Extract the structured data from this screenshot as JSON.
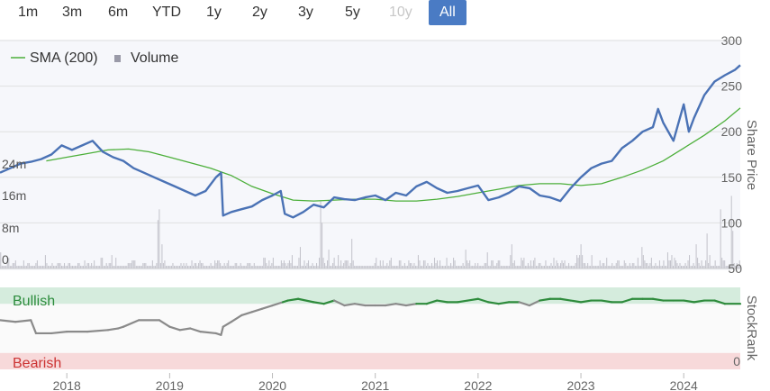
{
  "range_selector": {
    "buttons": [
      {
        "label": "1m",
        "state": "normal"
      },
      {
        "label": "3m",
        "state": "normal"
      },
      {
        "label": "6m",
        "state": "normal"
      },
      {
        "label": "YTD",
        "state": "normal"
      },
      {
        "label": "1y",
        "state": "normal"
      },
      {
        "label": "2y",
        "state": "normal"
      },
      {
        "label": "3y",
        "state": "normal"
      },
      {
        "label": "5y",
        "state": "normal"
      },
      {
        "label": "10y",
        "state": "disabled"
      },
      {
        "label": "All",
        "state": "active"
      }
    ]
  },
  "colors": {
    "price": "#4a72b5",
    "sma": "#4caf3a",
    "volume": "#c4c4cc",
    "bullish_band": "#d5ecdd",
    "bearish_band": "#f7d9da",
    "bullish_text": "#2c8c3c",
    "bearish_text": "#cc3333",
    "rank_bull": "#2e8b3c",
    "rank_neutral": "#8a8a8a",
    "grid": "#e0e0e0"
  },
  "chart_data": [
    {
      "type": "line",
      "name": "price-panel",
      "legend": [
        {
          "label": "SMA (200)",
          "icon": "line"
        },
        {
          "label": "Volume",
          "icon": "square"
        }
      ],
      "x_ticks": [
        "2018",
        "2019",
        "2020",
        "2021",
        "2022",
        "2023",
        "2024"
      ],
      "x_range": [
        2017.35,
        2024.55
      ],
      "y_axis_right": {
        "label": "Share Price",
        "ticks": [
          "50",
          "100",
          "150",
          "200",
          "250",
          "300"
        ],
        "ylim": [
          50,
          300
        ]
      },
      "y_axis_volume": {
        "ticks": [
          "0",
          "8m",
          "16m",
          "24m"
        ],
        "ylim": [
          0,
          35
        ]
      },
      "series": [
        {
          "name": "Price",
          "x": [
            2017.35,
            2017.45,
            2017.55,
            2017.65,
            2017.75,
            2017.85,
            2017.95,
            2018.05,
            2018.15,
            2018.25,
            2018.35,
            2018.45,
            2018.55,
            2018.65,
            2018.75,
            2018.85,
            2018.95,
            2019.05,
            2019.15,
            2019.25,
            2019.35,
            2019.45,
            2019.5,
            2019.52,
            2019.6,
            2019.7,
            2019.8,
            2019.9,
            2020.0,
            2020.08,
            2020.12,
            2020.2,
            2020.3,
            2020.4,
            2020.5,
            2020.6,
            2020.7,
            2020.8,
            2020.9,
            2021.0,
            2021.1,
            2021.2,
            2021.3,
            2021.4,
            2021.5,
            2021.6,
            2021.7,
            2021.8,
            2021.9,
            2022.0,
            2022.1,
            2022.2,
            2022.3,
            2022.4,
            2022.5,
            2022.6,
            2022.7,
            2022.8,
            2022.9,
            2023.0,
            2023.1,
            2023.2,
            2023.3,
            2023.4,
            2023.5,
            2023.6,
            2023.7,
            2023.75,
            2023.8,
            2023.9,
            2024.0,
            2024.05,
            2024.1,
            2024.2,
            2024.3,
            2024.4,
            2024.5,
            2024.55
          ],
          "values": [
            155,
            160,
            165,
            167,
            170,
            175,
            185,
            180,
            185,
            190,
            178,
            172,
            168,
            160,
            155,
            150,
            145,
            140,
            135,
            130,
            135,
            150,
            155,
            108,
            112,
            115,
            118,
            125,
            130,
            135,
            110,
            106,
            112,
            120,
            117,
            128,
            126,
            125,
            128,
            130,
            125,
            133,
            130,
            140,
            145,
            138,
            133,
            135,
            138,
            141,
            125,
            128,
            133,
            140,
            138,
            130,
            128,
            124,
            138,
            150,
            160,
            165,
            168,
            182,
            190,
            200,
            205,
            225,
            210,
            190,
            230,
            200,
            215,
            240,
            255,
            262,
            268,
            273
          ]
        },
        {
          "name": "SMA (200)",
          "x": [
            2017.8,
            2018.0,
            2018.2,
            2018.4,
            2018.6,
            2018.8,
            2019.0,
            2019.2,
            2019.4,
            2019.6,
            2019.8,
            2020.0,
            2020.2,
            2020.4,
            2020.6,
            2020.8,
            2021.0,
            2021.2,
            2021.4,
            2021.6,
            2021.8,
            2022.0,
            2022.2,
            2022.4,
            2022.6,
            2022.8,
            2023.0,
            2023.2,
            2023.4,
            2023.6,
            2023.8,
            2024.0,
            2024.2,
            2024.4,
            2024.55
          ],
          "values": [
            168,
            172,
            176,
            180,
            181,
            178,
            172,
            166,
            160,
            152,
            140,
            132,
            125,
            124,
            125,
            126,
            126,
            124,
            124,
            126,
            129,
            133,
            137,
            141,
            143,
            143,
            141,
            143,
            150,
            158,
            168,
            182,
            196,
            212,
            226
          ]
        }
      ]
    },
    {
      "type": "bar",
      "name": "volume",
      "x_range": [
        2017.35,
        2024.55
      ],
      "values": [
        6,
        1,
        1,
        1,
        1,
        3,
        4,
        1,
        1,
        2,
        2,
        3,
        1,
        1,
        1,
        1,
        1,
        3,
        1,
        1,
        2,
        2,
        1,
        1,
        1,
        1,
        2,
        3,
        1,
        1,
        1,
        1,
        1,
        5,
        2,
        1,
        1,
        1,
        2,
        1,
        1,
        1,
        2,
        2,
        2,
        1,
        1,
        2,
        1,
        1,
        2,
        2,
        1,
        1,
        1,
        1,
        1,
        2,
        2,
        1,
        1,
        1,
        3,
        1,
        2,
        2,
        1,
        2,
        1,
        3,
        1,
        1,
        1,
        1,
        4,
        4,
        1,
        1,
        2,
        1,
        2,
        2,
        5,
        1,
        1,
        4,
        1,
        1,
        1,
        1,
        1,
        1,
        1,
        1,
        2,
        2,
        2,
        3,
        3,
        3,
        1,
        1,
        1,
        1,
        1,
        2,
        2,
        2,
        1,
        1,
        1,
        1,
        3,
        1,
        1,
        2,
        18,
        22,
        2,
        9,
        2,
        3,
        1,
        1,
        1,
        1,
        1,
        2,
        1,
        1,
        1,
        1,
        1,
        2,
        1,
        2,
        1,
        2,
        1,
        1,
        1,
        3,
        1,
        2,
        2,
        1,
        2,
        3,
        2,
        2,
        1,
        1,
        1,
        1,
        1,
        2,
        1,
        1,
        3,
        2,
        3,
        3,
        2,
        1,
        1,
        2,
        1,
        2,
        3,
        1,
        1,
        1,
        1,
        2,
        2,
        1,
        1,
        2,
        1,
        1,
        1,
        1,
        2,
        2,
        2,
        1,
        1,
        2,
        1,
        1,
        1,
        1,
        1,
        1,
        4,
        4,
        2,
        1,
        3,
        1,
        2,
        4,
        1,
        1,
        1,
        1,
        1,
        3,
        2,
        3,
        2,
        1,
        2,
        3,
        2,
        5,
        1,
        1,
        1,
        1,
        4,
        8,
        1,
        1,
        3,
        1,
        2,
        3,
        1,
        1,
        2,
        1,
        1,
        2,
        1,
        4,
        25,
        17,
        4,
        2,
        1,
        3,
        7,
        1,
        1,
        2,
        4,
        1,
        1,
        5,
        1,
        3,
        1,
        2,
        3,
        3,
        3,
        1,
        2,
        11,
        3,
        1,
        1,
        1,
        1,
        1,
        1,
        1,
        1,
        1,
        1,
        1,
        1,
        1,
        1,
        1,
        2,
        4,
        1,
        1,
        3,
        1,
        3,
        1,
        1,
        2,
        1,
        3,
        4,
        1,
        1,
        1,
        1,
        1,
        3,
        3,
        1,
        1,
        2,
        1,
        1,
        3,
        2,
        2,
        1,
        2,
        1,
        1,
        5,
        3,
        1,
        1,
        3,
        3,
        1,
        2,
        1,
        1,
        2,
        1,
        4,
        2,
        3,
        1,
        3,
        1,
        1,
        1,
        1,
        4,
        1,
        1,
        2,
        1,
        4,
        3,
        1,
        1,
        1,
        1,
        1,
        2,
        1,
        7,
        3,
        2,
        3,
        1,
        1,
        1,
        2,
        1,
        2,
        1,
        1,
        1,
        1,
        2,
        2,
        6,
        1,
        1,
        3,
        3,
        1,
        1,
        2,
        3,
        3,
        1,
        1,
        1,
        1,
        1,
        1,
        1,
        5,
        9,
        2,
        3,
        1,
        1,
        1,
        1,
        4,
        3,
        4,
        1,
        1,
        2,
        1,
        3,
        1,
        3,
        4,
        1,
        1,
        2,
        2,
        1,
        1,
        1,
        3,
        1,
        1,
        1,
        2,
        1,
        4,
        1,
        3,
        2,
        1,
        2,
        3,
        2,
        3,
        1,
        1,
        2,
        1,
        1,
        1,
        1,
        2,
        5,
        4,
        5,
        9,
        5,
        2,
        2,
        1,
        2,
        1,
        1,
        5,
        1,
        1,
        1,
        1,
        1,
        3,
        1,
        2,
        2,
        1,
        4,
        1,
        1,
        1,
        2,
        1,
        1,
        2,
        3,
        3,
        1,
        1,
        1,
        3,
        2,
        1,
        1,
        2,
        1,
        2,
        2,
        1,
        1,
        4,
        1,
        1,
        8,
        5,
        3,
        2,
        2,
        1,
        2,
        4,
        1,
        1,
        2,
        1,
        1,
        3,
        1,
        1,
        3,
        1,
        1,
        6,
        3,
        3,
        5,
        1,
        4,
        3,
        2,
        1,
        2,
        1,
        1,
        1,
        2,
        1,
        3,
        5,
        1,
        1,
        2,
        1,
        9,
        4,
        2,
        1,
        3,
        1,
        1,
        3,
        13,
        2,
        5,
        1,
        1,
        1,
        3,
        1,
        1,
        1,
        22,
        4,
        3,
        3,
        1,
        1,
        1,
        1,
        27,
        14,
        2,
        1,
        2,
        1,
        3
      ]
    },
    {
      "type": "line",
      "name": "stockrank",
      "y_axis_right": {
        "label": "StockRank",
        "ticks": [
          "0"
        ],
        "ylim": [
          0,
          100
        ]
      },
      "bands": [
        {
          "label": "Bullish",
          "from": 80,
          "to": 100
        },
        {
          "label": "Bearish",
          "from": 0,
          "to": 20
        }
      ],
      "series": [
        {
          "name": "StockRank",
          "x": [
            2017.35,
            2017.5,
            2017.65,
            2017.7,
            2017.85,
            2018.0,
            2018.2,
            2018.4,
            2018.5,
            2018.55,
            2018.7,
            2018.9,
            2019.0,
            2019.1,
            2019.2,
            2019.3,
            2019.45,
            2019.5,
            2019.52,
            2019.6,
            2019.7,
            2019.8,
            2019.9,
            2020.0,
            2020.1,
            2020.15,
            2020.25,
            2020.4,
            2020.5,
            2020.6,
            2020.7,
            2020.8,
            2020.9,
            2021.0,
            2021.1,
            2021.2,
            2021.3,
            2021.4,
            2021.5,
            2021.6,
            2021.7,
            2021.8,
            2021.9,
            2022.0,
            2022.1,
            2022.2,
            2022.3,
            2022.4,
            2022.5,
            2022.6,
            2022.7,
            2022.8,
            2022.9,
            2023.0,
            2023.1,
            2023.2,
            2023.3,
            2023.4,
            2023.5,
            2023.6,
            2023.7,
            2023.8,
            2023.9,
            2024.0,
            2024.1,
            2024.2,
            2024.3,
            2024.4,
            2024.55
          ],
          "values": [
            60,
            58,
            60,
            44,
            44,
            46,
            46,
            48,
            50,
            52,
            60,
            60,
            52,
            48,
            50,
            46,
            44,
            42,
            52,
            58,
            66,
            70,
            74,
            78,
            82,
            84,
            86,
            82,
            80,
            84,
            78,
            80,
            78,
            78,
            78,
            80,
            78,
            80,
            80,
            84,
            82,
            82,
            84,
            86,
            82,
            80,
            82,
            82,
            78,
            84,
            86,
            86,
            84,
            82,
            84,
            84,
            82,
            82,
            86,
            86,
            86,
            84,
            84,
            84,
            82,
            84,
            84,
            80,
            80
          ]
        }
      ]
    }
  ]
}
